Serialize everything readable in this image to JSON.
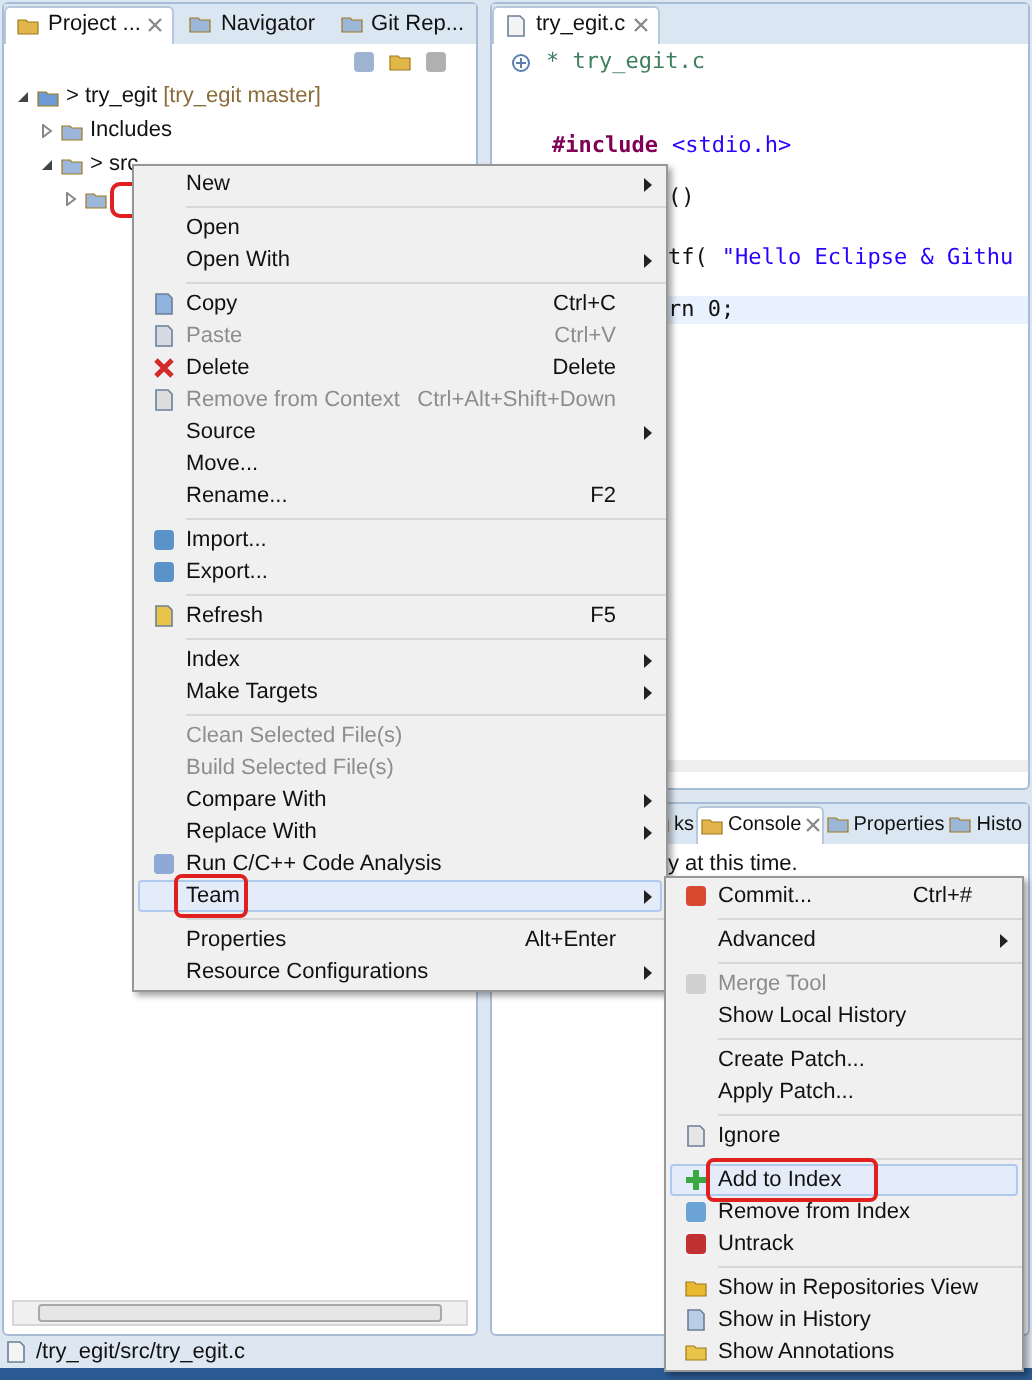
{
  "left_panel": {
    "tabs": [
      {
        "label": "Project ...",
        "selected": true,
        "closable": true
      },
      {
        "label": "Navigator",
        "selected": false,
        "closable": false
      },
      {
        "label": "Git Rep...",
        "selected": false,
        "closable": false
      }
    ],
    "tree": [
      {
        "label": "> try_egit",
        "decoration": "[try_egit master]",
        "expanded": true,
        "children": [
          {
            "label": "Includes",
            "expanded": false
          },
          {
            "label": "> src",
            "expanded": true,
            "children": [
              {
                "selected": true,
                "circled": true,
                "expanded": false
              }
            ]
          }
        ]
      }
    ]
  },
  "editor": {
    "tab": {
      "label": "try_egit.c",
      "selected": true
    },
    "lines": [
      {
        "current": false,
        "tokens": [
          {
            "kind": "comment",
            "text": "* try_egit.c"
          }
        ]
      },
      {
        "current": false,
        "tokens": [
          {
            "kind": "keyword",
            "text": "#include"
          },
          {
            "kind": "string",
            "text": "<stdio.h>"
          }
        ]
      },
      {
        "current": false,
        "tokens": [
          {
            "kind": "code",
            "text": "()"
          }
        ]
      },
      {
        "current": false,
        "tokens": [
          {
            "kind": "code",
            "text": "tf("
          },
          {
            "kind": "string",
            "text": "\"Hello Eclipse & Githu"
          }
        ]
      },
      {
        "current": true,
        "tokens": [
          {
            "kind": "code",
            "text": "rn 0;"
          }
        ]
      }
    ]
  },
  "bottom_panel": {
    "tabs": [
      {
        "label": "ks",
        "selected": false,
        "closable": false
      },
      {
        "label": "Console",
        "selected": true,
        "closable": true
      },
      {
        "label": "Properties",
        "selected": false,
        "closable": false
      },
      {
        "label": "Histo",
        "selected": false,
        "closable": false
      }
    ],
    "message": "y at this time."
  },
  "context_menu": {
    "items": [
      {
        "kind": "item",
        "label": "New",
        "submenu": true,
        "disabled": false,
        "selected": false,
        "circled": false
      },
      {
        "kind": "separator"
      },
      {
        "kind": "item",
        "label": "Open",
        "submenu": false,
        "disabled": false,
        "selected": false,
        "circled": false
      },
      {
        "kind": "item",
        "label": "Open With",
        "submenu": true,
        "disabled": false,
        "selected": false,
        "circled": false
      },
      {
        "kind": "separator"
      },
      {
        "kind": "item",
        "label": "Copy",
        "shortcut": "Ctrl+C",
        "submenu": false,
        "disabled": false,
        "selected": false,
        "circled": false
      },
      {
        "kind": "item",
        "label": "Paste",
        "shortcut": "Ctrl+V",
        "submenu": false,
        "disabled": true,
        "selected": false,
        "circled": false
      },
      {
        "kind": "item",
        "label": "Delete",
        "shortcut": "Delete",
        "submenu": false,
        "disabled": false,
        "selected": false,
        "circled": false
      },
      {
        "kind": "item",
        "label": "Remove from Context",
        "shortcut": "Ctrl+Alt+Shift+Down",
        "submenu": false,
        "disabled": true,
        "selected": false,
        "circled": false
      },
      {
        "kind": "item",
        "label": "Source",
        "submenu": true,
        "disabled": false,
        "selected": false,
        "circled": false
      },
      {
        "kind": "item",
        "label": "Move...",
        "submenu": false,
        "disabled": false,
        "selected": false,
        "circled": false
      },
      {
        "kind": "item",
        "label": "Rename...",
        "shortcut": "F2",
        "submenu": false,
        "disabled": false,
        "selected": false,
        "circled": false
      },
      {
        "kind": "separator"
      },
      {
        "kind": "item",
        "label": "Import...",
        "submenu": false,
        "disabled": false,
        "selected": false,
        "circled": false
      },
      {
        "kind": "item",
        "label": "Export...",
        "submenu": false,
        "disabled": false,
        "selected": false,
        "circled": false
      },
      {
        "kind": "separator"
      },
      {
        "kind": "item",
        "label": "Refresh",
        "shortcut": "F5",
        "submenu": false,
        "disabled": false,
        "selected": false,
        "circled": false
      },
      {
        "kind": "separator"
      },
      {
        "kind": "item",
        "label": "Index",
        "submenu": true,
        "disabled": false,
        "selected": false,
        "circled": false
      },
      {
        "kind": "item",
        "label": "Make Targets",
        "submenu": true,
        "disabled": false,
        "selected": false,
        "circled": false
      },
      {
        "kind": "separator"
      },
      {
        "kind": "item",
        "label": "Clean Selected File(s)",
        "submenu": false,
        "disabled": true,
        "selected": false,
        "circled": false
      },
      {
        "kind": "item",
        "label": "Build Selected File(s)",
        "submenu": false,
        "disabled": true,
        "selected": false,
        "circled": false
      },
      {
        "kind": "item",
        "label": "Compare With",
        "submenu": true,
        "disabled": false,
        "selected": false,
        "circled": false
      },
      {
        "kind": "item",
        "label": "Replace With",
        "submenu": true,
        "disabled": false,
        "selected": false,
        "circled": false
      },
      {
        "kind": "item",
        "label": "Run C/C++ Code Analysis",
        "submenu": false,
        "disabled": false,
        "selected": false,
        "circled": false
      },
      {
        "kind": "item",
        "label": "Team",
        "submenu": true,
        "disabled": false,
        "selected": true,
        "circled": true
      },
      {
        "kind": "separator"
      },
      {
        "kind": "item",
        "label": "Properties",
        "shortcut": "Alt+Enter",
        "submenu": false,
        "disabled": false,
        "selected": false,
        "circled": false
      },
      {
        "kind": "item",
        "label": "Resource Configurations",
        "submenu": true,
        "disabled": false,
        "selected": false,
        "circled": false
      }
    ]
  },
  "team_menu": {
    "items": [
      {
        "kind": "item",
        "label": "Commit...",
        "shortcut": "Ctrl+#",
        "submenu": false,
        "disabled": false,
        "selected": false,
        "circled": false
      },
      {
        "kind": "separator"
      },
      {
        "kind": "item",
        "label": "Advanced",
        "submenu": true,
        "disabled": false,
        "selected": false,
        "circled": false
      },
      {
        "kind": "separator"
      },
      {
        "kind": "item",
        "label": "Merge Tool",
        "submenu": false,
        "disabled": true,
        "selected": false,
        "circled": false
      },
      {
        "kind": "item",
        "label": "Show Local History",
        "submenu": false,
        "disabled": false,
        "selected": false,
        "circled": false
      },
      {
        "kind": "separator"
      },
      {
        "kind": "item",
        "label": "Create Patch...",
        "submenu": false,
        "disabled": false,
        "selected": false,
        "circled": false
      },
      {
        "kind": "item",
        "label": "Apply Patch...",
        "submenu": false,
        "disabled": false,
        "selected": false,
        "circled": false
      },
      {
        "kind": "separator"
      },
      {
        "kind": "item",
        "label": "Ignore",
        "submenu": false,
        "disabled": false,
        "selected": false,
        "circled": false
      },
      {
        "kind": "separator"
      },
      {
        "kind": "item",
        "label": "Add to Index",
        "submenu": false,
        "disabled": false,
        "selected": true,
        "circled": true
      },
      {
        "kind": "item",
        "label": "Remove from Index",
        "submenu": false,
        "disabled": false,
        "selected": false,
        "circled": false
      },
      {
        "kind": "item",
        "label": "Untrack",
        "submenu": false,
        "disabled": false,
        "selected": false,
        "circled": false
      },
      {
        "kind": "separator"
      },
      {
        "kind": "item",
        "label": "Show in Repositories View",
        "submenu": false,
        "disabled": false,
        "selected": false,
        "circled": false
      },
      {
        "kind": "item",
        "label": "Show in History",
        "submenu": false,
        "disabled": false,
        "selected": false,
        "circled": false
      },
      {
        "kind": "item",
        "label": "Show Annotations",
        "submenu": false,
        "disabled": false,
        "selected": false,
        "circled": false
      }
    ]
  },
  "status_bar": {
    "path": "/try_egit/src/try_egit.c"
  }
}
